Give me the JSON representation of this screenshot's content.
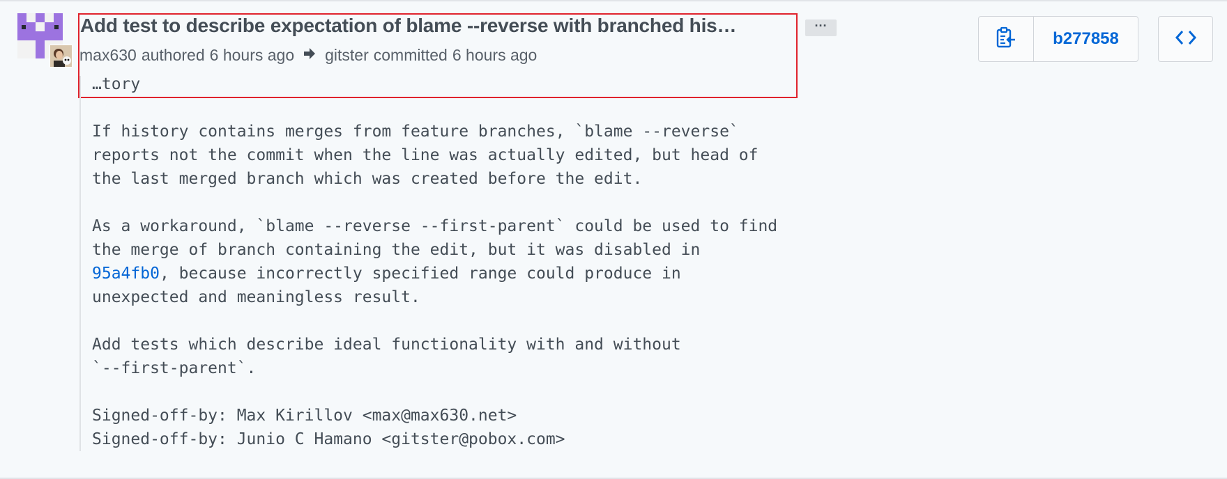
{
  "commit": {
    "title": "Add test to describe expectation of blame --reverse with branched his…",
    "more_button": "···",
    "author": "max630",
    "authored_text": "authored",
    "authored_time": "6 hours ago",
    "committer": "gitster",
    "committed_text": "committed",
    "committed_time": "6 hours ago",
    "body": {
      "line_01": "…tory",
      "line_02": "If history contains merges from feature branches, `blame --reverse`",
      "line_03": "reports not the commit when the line was actually edited, but head of",
      "line_04": "the last merged branch which was created before the edit.",
      "line_05": "As a workaround, `blame --reverse --first-parent` could be used to find",
      "line_06": "the merge of branch containing the edit, but it was disabled in",
      "line_07_sha": "95a4fb0",
      "line_07_rest": ", because incorrectly specified range could produce in",
      "line_08": "unexpected and meaningless result.",
      "line_09": "Add tests which describe ideal functionality with and without",
      "line_10": "`--first-parent`.",
      "line_11": "Signed-off-by: Max Kirillov <max@max630.net>",
      "line_12": "Signed-off-by: Junio C Hamano <gitster@pobox.com>"
    },
    "sha_button": "b277858"
  },
  "icons": {
    "copy": "clippy-icon",
    "browse": "code-icon",
    "arrow": "arrow-right-icon"
  },
  "colors": {
    "link": "#0366d6",
    "highlight": "#e0232d",
    "avatar_purple": "#9c73e0"
  }
}
